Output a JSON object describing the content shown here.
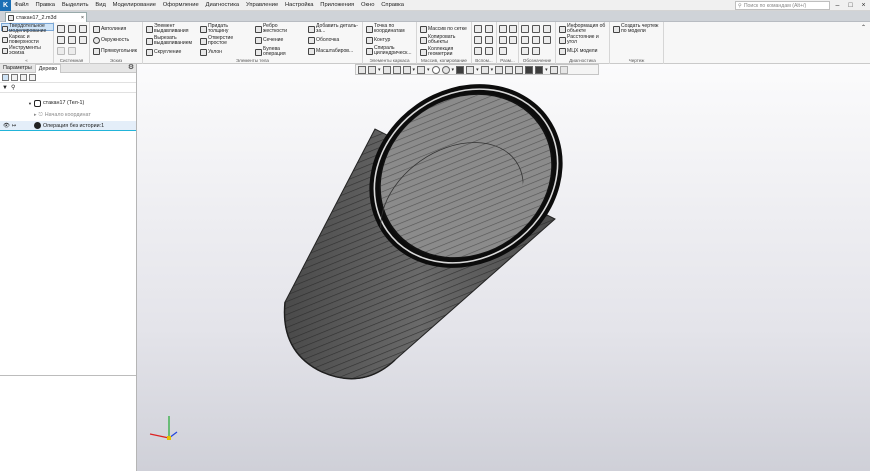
{
  "menu": {
    "logo": "K",
    "items": [
      "Файл",
      "Правка",
      "Выделить",
      "Вид",
      "Моделирование",
      "Оформление",
      "Диагностика",
      "Управление",
      "Настройка",
      "Приложения",
      "Окно",
      "Справка"
    ],
    "search_placeholder": "Поиск по командам (Alt+/)"
  },
  "document": {
    "tab_label": "стакан17_2.m3d"
  },
  "ribbon": {
    "mode_items": [
      "Твердотельное моделирование",
      "Каркас и поверхности",
      "Инструменты эскиза"
    ],
    "groups": {
      "system": "Системная",
      "sketch": "Эскиз",
      "body_elements": "Элементы тела",
      "frame_elements": "Элементы каркаса",
      "copy_arrays": "Массив, копирование",
      "aux": "Вспом...",
      "sizes": "Разм...",
      "notation": "Обозначение",
      "diagnostics": "Диагностика",
      "drawing": "Чертеж"
    },
    "sketch_items": [
      "Автолиния",
      "Окружность",
      "Прямоугольник"
    ],
    "body_items": [
      "Элемент выдавливания",
      "Вырезать выдавливанием",
      "Скругление",
      "Придать толщину",
      "Отверстие простое",
      "Уклон",
      "Ребро жесткости",
      "Сечение",
      "Булева операция",
      "Добавить деталь-за...",
      "Оболочка",
      "Масштабиров..."
    ],
    "frame_items": [
      "Точка по координатам",
      "Контур",
      "Спираль цилиндрическ..."
    ],
    "copy_items": [
      "Массив по сетке",
      "Копировать объекты",
      "Коллекция геометрии"
    ],
    "diag_items": [
      "Информация об объекте",
      "Расстояние и угол",
      "МЦХ модели"
    ],
    "drawing_item": "Создать чертеж по модели"
  },
  "panel": {
    "tab_params": "Параметры",
    "tab_tree": "Дерево",
    "tree": {
      "root": "стакан17 (Тел-1)",
      "origin": "Начало координат",
      "operation": "Операция без истории:1"
    }
  }
}
